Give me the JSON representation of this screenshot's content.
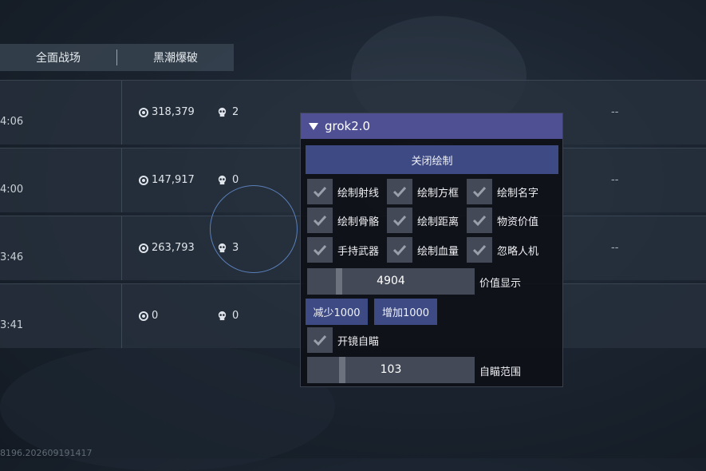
{
  "tabs": [
    "全面战场",
    "黑潮爆破"
  ],
  "rows": [
    {
      "time": "4:06",
      "coins": "318,379",
      "kills": "2",
      "extra": "--"
    },
    {
      "time": "4:00",
      "coins": "147,917",
      "kills": "0",
      "extra": "--"
    },
    {
      "time": "3:46",
      "coins": "263,793",
      "kills": "3",
      "extra": "--"
    },
    {
      "time": "3:41",
      "coins": "0",
      "kills": "0",
      "extra": ""
    }
  ],
  "watermark": "8196.202609191417",
  "menu": {
    "title": "grok2.0",
    "close_draw": "关闭绘制",
    "checkboxes": [
      {
        "label": "绘制射线",
        "checked": true
      },
      {
        "label": "绘制方框",
        "checked": true
      },
      {
        "label": "绘制名字",
        "checked": true
      },
      {
        "label": "绘制骨骼",
        "checked": true
      },
      {
        "label": "绘制距离",
        "checked": true
      },
      {
        "label": "物资价值",
        "checked": true
      },
      {
        "label": "手持武器",
        "checked": true
      },
      {
        "label": "绘制血量",
        "checked": true
      },
      {
        "label": "忽略人机",
        "checked": true
      }
    ],
    "value_slider": {
      "value": "4904",
      "label": "价值显示",
      "level": 0.18
    },
    "decrease": "减少1000",
    "increase": "增加1000",
    "aim_toggle": {
      "label": "开镜自瞄",
      "checked": true
    },
    "aim_slider": {
      "value": "103",
      "label": "自瞄范围",
      "level": 0.2
    }
  }
}
